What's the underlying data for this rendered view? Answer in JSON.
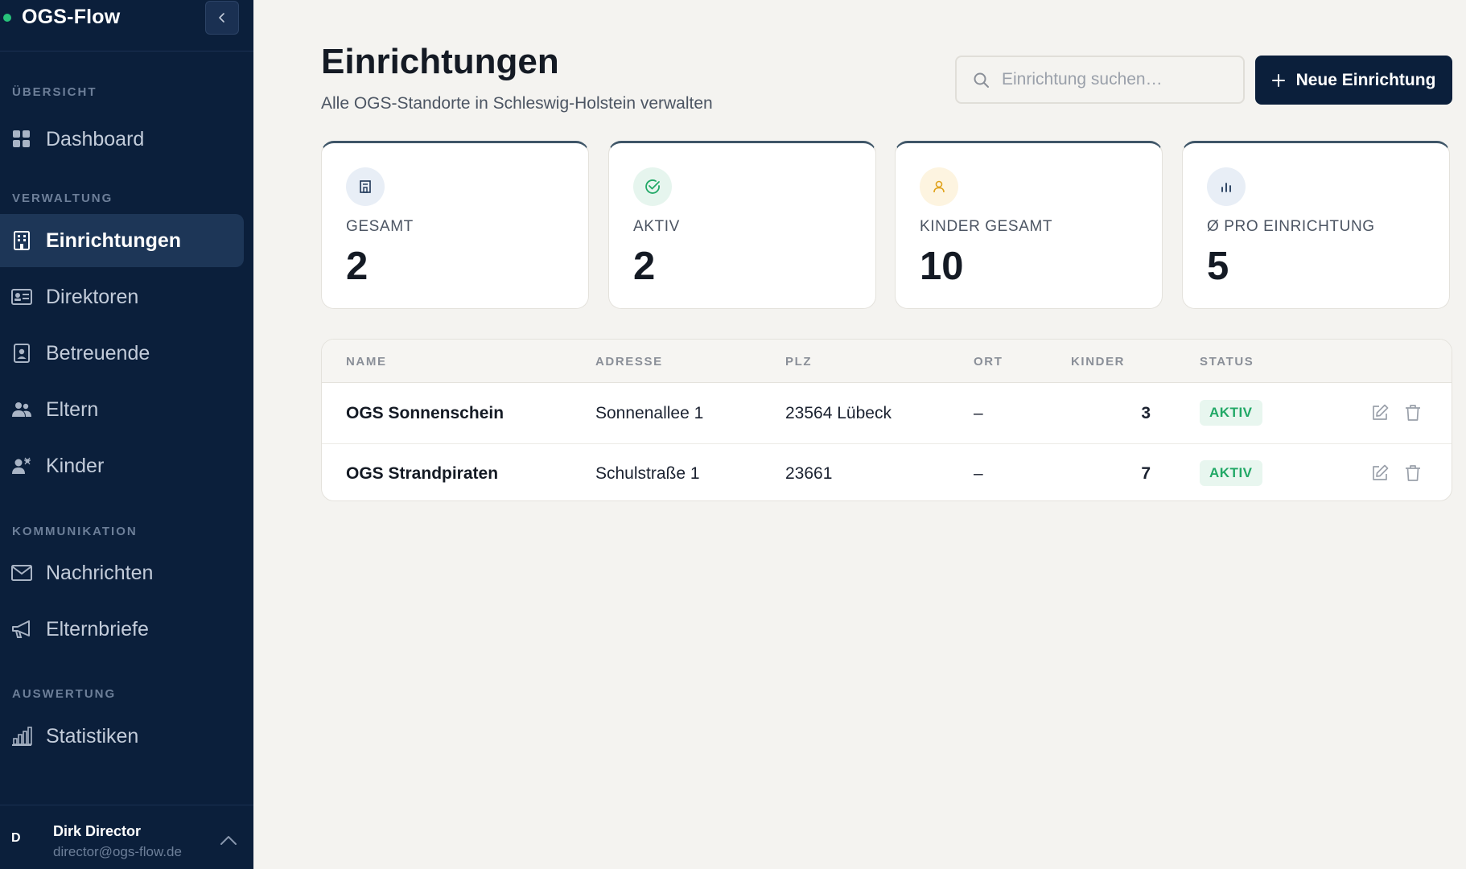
{
  "app": {
    "name": "OGS-Flow"
  },
  "sidebar": {
    "sections": [
      {
        "label": "ÜBERSICHT"
      },
      {
        "label": "VERWALTUNG"
      },
      {
        "label": "KOMMUNIKATION"
      },
      {
        "label": "AUSWERTUNG"
      }
    ],
    "items": [
      {
        "label": "Dashboard",
        "icon": "grid-icon"
      },
      {
        "label": "Einrichtungen",
        "icon": "building-icon",
        "active": true
      },
      {
        "label": "Direktoren",
        "icon": "id-card-icon"
      },
      {
        "label": "Betreuende",
        "icon": "badge-icon"
      },
      {
        "label": "Eltern",
        "icon": "users-icon"
      },
      {
        "label": "Kinder",
        "icon": "child-icon"
      },
      {
        "label": "Nachrichten",
        "icon": "mail-icon"
      },
      {
        "label": "Elternbriefe",
        "icon": "megaphone-icon"
      },
      {
        "label": "Statistiken",
        "icon": "bar-chart-icon"
      }
    ],
    "user": {
      "initial": "D",
      "name": "Dirk Director",
      "email": "director@ogs-flow.de"
    }
  },
  "header": {
    "title": "Einrichtungen",
    "subtitle": "Alle OGS-Standorte in Schleswig-Holstein verwalten",
    "search_placeholder": "Einrichtung suchen…",
    "new_button_label": "Neue Einrichtung"
  },
  "stats": [
    {
      "label": "GESAMT",
      "value": "2",
      "icon": "building-icon",
      "color": "#1d3657"
    },
    {
      "label": "AKTIV",
      "value": "2",
      "icon": "check-circle-icon",
      "color": "#21a866"
    },
    {
      "label": "KINDER GESAMT",
      "value": "10",
      "icon": "person-icon",
      "color": "#e0a21a"
    },
    {
      "label": "Ø PRO EINRICHTUNG",
      "value": "5",
      "icon": "bar-chart-icon",
      "color": "#1d3657"
    }
  ],
  "table": {
    "columns": [
      "NAME",
      "ADRESSE",
      "PLZ",
      "ORT",
      "KINDER",
      "STATUS"
    ],
    "rows": [
      {
        "name": "OGS Sonnenschein",
        "address": "Sonnenallee 1",
        "plz": "23564 Lübeck",
        "ort": "–",
        "kinder": "3",
        "status": "AKTIV"
      },
      {
        "name": "OGS Strandpiraten",
        "address": "Schulstraße 1",
        "plz": "23661",
        "ort": "–",
        "kinder": "7",
        "status": "AKTIV"
      }
    ]
  },
  "colors": {
    "sidebar_bg": "#0b1f3b",
    "accent_green": "#27c27a",
    "page_bg": "#f4f3f0"
  }
}
